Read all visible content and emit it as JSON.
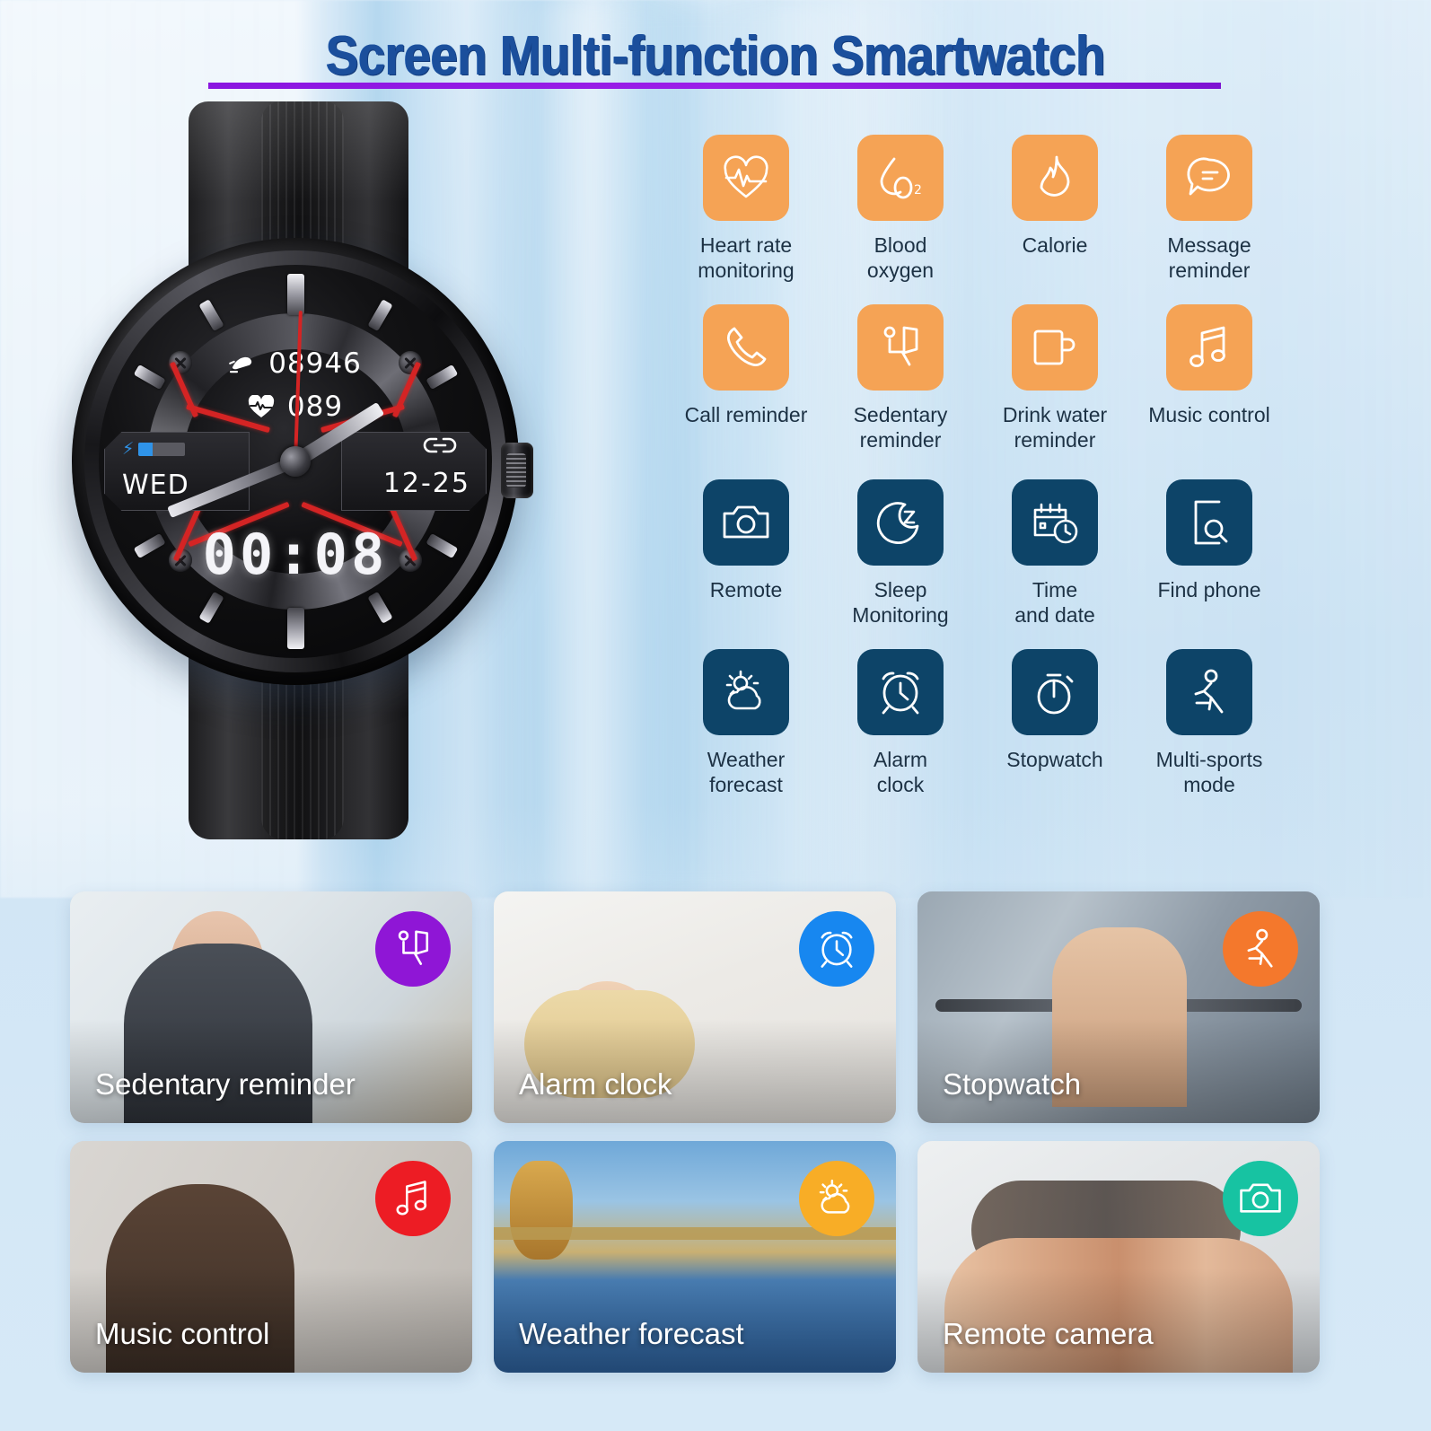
{
  "page": {
    "title": "Screen Multi-function Smartwatch",
    "title_color": "#1b4f9c",
    "underline_color": "#8a16e0",
    "background_color": "#d6e8f6"
  },
  "watch": {
    "name": "smartwatch-product-photo",
    "face": {
      "steps_value": "08946",
      "heart_rate_value": "089",
      "weekday": "WED",
      "date": "12-25",
      "digital_time": "00:08",
      "steps_icon": "shoe-steps-icon",
      "heart_icon": "heartbeat-icon",
      "battery_icon": "battery-charging-icon",
      "link_icon": "bluetooth-link-icon"
    },
    "crown": "side-crown-button",
    "strap": "silicone-strap",
    "accent_color": "#d42424"
  },
  "features": {
    "orange_color": "#f5a355",
    "navy_color": "#0d4468",
    "rows": [
      [
        {
          "label": "Heart rate\nmonitoring",
          "icon": "heart-rate-icon",
          "tone": "orange"
        },
        {
          "label": "Blood\noxygen",
          "icon": "blood-oxygen-icon",
          "tone": "orange"
        },
        {
          "label": "Calorie",
          "icon": "calorie-flame-icon",
          "tone": "orange"
        },
        {
          "label": "Message\nreminder",
          "icon": "message-bubble-icon",
          "tone": "orange"
        }
      ],
      [
        {
          "label": "Call reminder",
          "icon": "phone-call-icon",
          "tone": "orange"
        },
        {
          "label": "Sedentary\nreminder",
          "icon": "sedentary-person-icon",
          "tone": "orange"
        },
        {
          "label": "Drink water\nreminder",
          "icon": "water-mug-icon",
          "tone": "orange"
        },
        {
          "label": "Music control",
          "icon": "music-note-icon",
          "tone": "orange"
        }
      ],
      [
        {
          "label": "Remote",
          "icon": "camera-icon",
          "tone": "navy"
        },
        {
          "label": "Sleep\nMonitoring",
          "icon": "sleep-moon-z-icon",
          "tone": "navy"
        },
        {
          "label": "Time\nand date",
          "icon": "calendar-clock-icon",
          "tone": "navy"
        },
        {
          "label": "Find phone",
          "icon": "find-phone-icon",
          "tone": "navy"
        }
      ],
      [
        {
          "label": "Weather\nforecast",
          "icon": "sun-cloud-icon",
          "tone": "navy"
        },
        {
          "label": "Alarm\nclock",
          "icon": "alarm-clock-icon",
          "tone": "navy"
        },
        {
          "label": "Stopwatch",
          "icon": "stopwatch-icon",
          "tone": "navy"
        },
        {
          "label": "Multi-sports\nmode",
          "icon": "running-person-icon",
          "tone": "navy"
        }
      ]
    ]
  },
  "cards": {
    "rows": [
      [
        {
          "caption": "Sedentary reminder",
          "icon": "sedentary-person-icon",
          "badge_color": "#8f16d6",
          "scene": "sc-office"
        },
        {
          "caption": "Alarm clock",
          "icon": "alarm-clock-icon",
          "badge_color": "#1787f0",
          "scene": "sc-sleep"
        },
        {
          "caption": "Stopwatch",
          "icon": "running-person-icon",
          "badge_color": "#f4782c",
          "scene": "sc-gym"
        }
      ],
      [
        {
          "caption": "Music control",
          "icon": "music-note-icon",
          "badge_color": "#ed1c24",
          "scene": "sc-music"
        },
        {
          "caption": "Weather forecast",
          "icon": "sun-cloud-icon",
          "badge_color": "#f8ad26",
          "scene": "sc-weather"
        },
        {
          "caption": "Remote camera",
          "icon": "camera-icon",
          "badge_color": "#17c3a2",
          "scene": "sc-selfie"
        }
      ]
    ]
  }
}
